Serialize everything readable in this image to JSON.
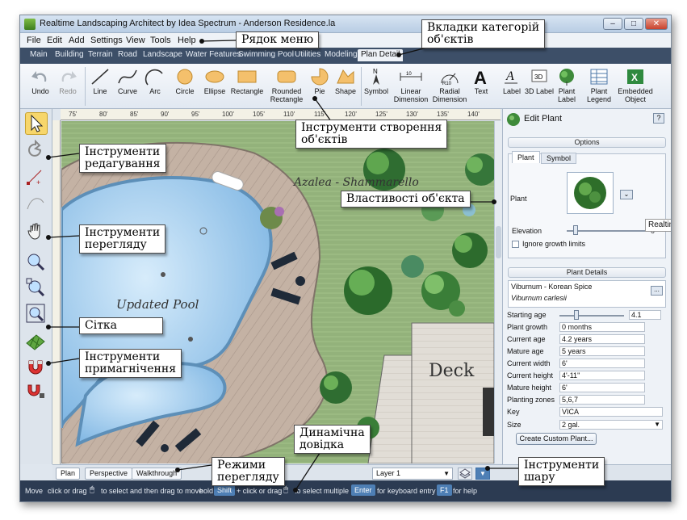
{
  "window": {
    "title": "Realtime Landscaping Architect by Idea Spectrum - Anderson Residence.la",
    "controls": [
      "minimize-icon",
      "maximize-icon",
      "close-icon"
    ]
  },
  "menu": [
    "File",
    "Edit",
    "Add",
    "Settings",
    "View",
    "Tools",
    "Help"
  ],
  "tabs": [
    "Main",
    "Building",
    "Terrain",
    "Road",
    "Landscape",
    "Water Features",
    "Swimming Pool",
    "Utilities",
    "Modeling",
    "Plan Detail"
  ],
  "active_tab": "Plan Detail",
  "ribbon": {
    "history": [
      {
        "label": "Undo",
        "icon": "undo-icon"
      },
      {
        "label": "Redo",
        "icon": "redo-icon"
      }
    ],
    "shapes": [
      {
        "label": "Line",
        "icon": "line-icon"
      },
      {
        "label": "Curve",
        "icon": "curve-icon"
      },
      {
        "label": "Arc",
        "icon": "arc-icon"
      },
      {
        "label": "Circle",
        "icon": "circle-icon"
      },
      {
        "label": "Ellipse",
        "icon": "ellipse-icon"
      },
      {
        "label": "Rectangle",
        "icon": "rectangle-icon"
      },
      {
        "label": "Rounded Rectangle",
        "icon": "rounded-rectangle-icon"
      },
      {
        "label": "Pie",
        "icon": "pie-icon"
      },
      {
        "label": "Shape",
        "icon": "shape-icon"
      }
    ],
    "annotations": [
      {
        "label": "Symbol",
        "icon": "north-arrow-icon"
      },
      {
        "label": "Linear Dimension",
        "icon": "linear-dimension-icon"
      },
      {
        "label": "Radial Dimension",
        "icon": "radial-dimension-icon"
      },
      {
        "label": "Text",
        "icon": "text-icon"
      },
      {
        "label": "Label",
        "icon": "label-icon"
      },
      {
        "label": "3D Label",
        "icon": "3d-label-icon"
      },
      {
        "label": "Plant Label",
        "icon": "plant-label-icon"
      },
      {
        "label": "Plant Legend",
        "icon": "plant-legend-icon"
      },
      {
        "label": "Embedded Object",
        "icon": "embedded-object-icon"
      }
    ]
  },
  "ruler_marks": [
    "75'",
    "80'",
    "85'",
    "90'",
    "95'",
    "100'",
    "105'",
    "110'",
    "115'",
    "120'",
    "125'",
    "130'",
    "135'",
    "140'",
    "145'"
  ],
  "canvas": {
    "pool_label": "Updated Pool",
    "plant_label": "Azalea - Shammarello",
    "deck_label": "Deck"
  },
  "panel": {
    "title": "Edit Plant",
    "help": "?",
    "options_header": "Options",
    "sub_tabs": [
      "Plant",
      "Symbol"
    ],
    "plant_label": "Plant",
    "tooltip_fragment": "Realtime",
    "elevation_label": "Elevation",
    "elevation_value": "0\"",
    "ignore_growth_label": "Ignore growth limits",
    "details_header": "Plant Details",
    "plant_name": "Viburnum - Korean Spice",
    "plant_latin": "Viburnum carlesii",
    "starting_age_label": "Starting age",
    "starting_age_value": "4.1",
    "rows": [
      {
        "label": "Plant growth",
        "value": "0 months"
      },
      {
        "label": "Current age",
        "value": "4.2 years"
      },
      {
        "label": "Mature age",
        "value": "5 years"
      },
      {
        "label": "Current width",
        "value": "6'"
      },
      {
        "label": "Current height",
        "value": "4'-11\""
      },
      {
        "label": "Mature height",
        "value": "6'"
      },
      {
        "label": "Planting zones",
        "value": "5,6,7"
      },
      {
        "label": "Key",
        "value": "VICA"
      },
      {
        "label": "Size",
        "value": "2 gal."
      }
    ],
    "create_button": "Create Custom Plant..."
  },
  "view_tabs": [
    "Plan",
    "Perspective",
    "Walkthrough"
  ],
  "layer": "Layer 1",
  "status": {
    "mode": "Move",
    "parts": [
      "click or drag",
      "to select and then drag to move",
      "hold",
      "Shift",
      "+ click or drag",
      "to select multiple",
      "Enter",
      "for keyboard entry",
      "F1",
      "for help"
    ]
  },
  "callouts": {
    "menu_bar": "Рядок меню",
    "object_tabs": "Вкладки категорій\nоб'єктів",
    "creation_tools": "Інструменти створення\nоб'єктів",
    "edit_tools": "Інструменти\nредагування",
    "object_properties": "Властивості  об'єкта",
    "view_tools": "Інструменти\nперегляду",
    "grid": "Сітка",
    "snap_tools": "Інструменти\nпримагнічення",
    "dynamic_help": "Динамічна\nдовідка",
    "view_modes": "Режими\nперегляду",
    "layer_tools": "Інструменти\nшару"
  }
}
